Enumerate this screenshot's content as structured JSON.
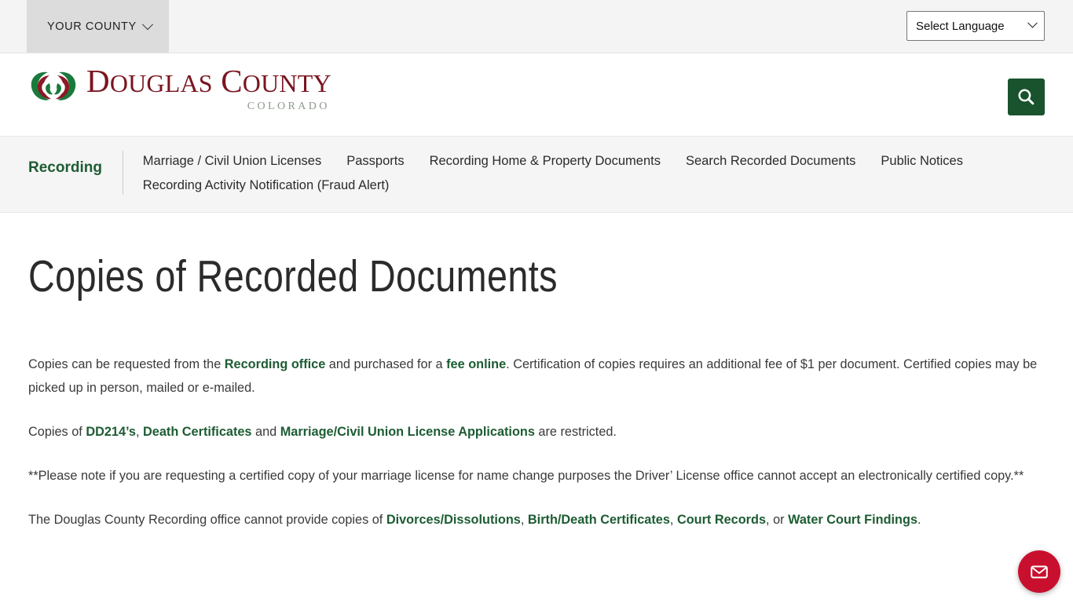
{
  "utility_bar": {
    "county_tab_label": "YOUR COUNTY",
    "language_selector_value": "Select Language"
  },
  "masthead": {
    "logo_title_main": "D",
    "logo_title_rest": "OUGLAS",
    "logo_title_main2": "C",
    "logo_title_rest2": "OUNTY",
    "logo_subtitle": "COLORADO",
    "search_icon": "search-icon"
  },
  "section_nav": {
    "title": "Recording",
    "links": [
      {
        "label": "Marriage / Civil Union Licenses"
      },
      {
        "label": "Passports"
      },
      {
        "label": "Recording Home & Property Documents"
      },
      {
        "label": "Search Recorded Documents"
      },
      {
        "label": "Public Notices"
      },
      {
        "label": "Recording Activity Notification (Fraud Alert)"
      }
    ]
  },
  "main": {
    "page_title": "Copies of Recorded Documents",
    "paragraph1": {
      "t1": "Copies can be requested from the ",
      "l1": "Recording office",
      "t2": " and purchased for a ",
      "l2": "fee online",
      "t3": ".   Certification of copies requires an additional fee of $1 per document.  Certified copies may be picked up in person, mailed or e-mailed."
    },
    "paragraph2": {
      "t1": "Copies of ",
      "l1": "DD214’s",
      "t2": ", ",
      "l2": "Death Certificates",
      "t3": " and ",
      "l3": "Marriage/Civil Union License Applications",
      "t4": " are restricted."
    },
    "paragraph3": {
      "t1": "**Please note if you are requesting a certified copy of your marriage license for name change purposes the Driver’ License office cannot accept an electronically certified copy.**"
    },
    "paragraph4": {
      "t1": "The Douglas County Recording office cannot provide copies of ",
      "l1": "Divorces/Dissolutions",
      "t2": ", ",
      "l2": "Birth/Death Certificates",
      "t3": ", ",
      "l3": "Court Records",
      "t4": ", or ",
      "l4": "Water Court Findings",
      "t5": "."
    }
  },
  "chat_widget": {
    "icon": "envelope-icon"
  },
  "colors": {
    "brand_green": "#1d5c33",
    "brand_maroon": "#7a1520",
    "logo_green": "#1a7a3c",
    "chat_red": "#c8102e",
    "utility_bar_bg": "#f4f4f4",
    "nav_bg": "#f5f5f5"
  }
}
